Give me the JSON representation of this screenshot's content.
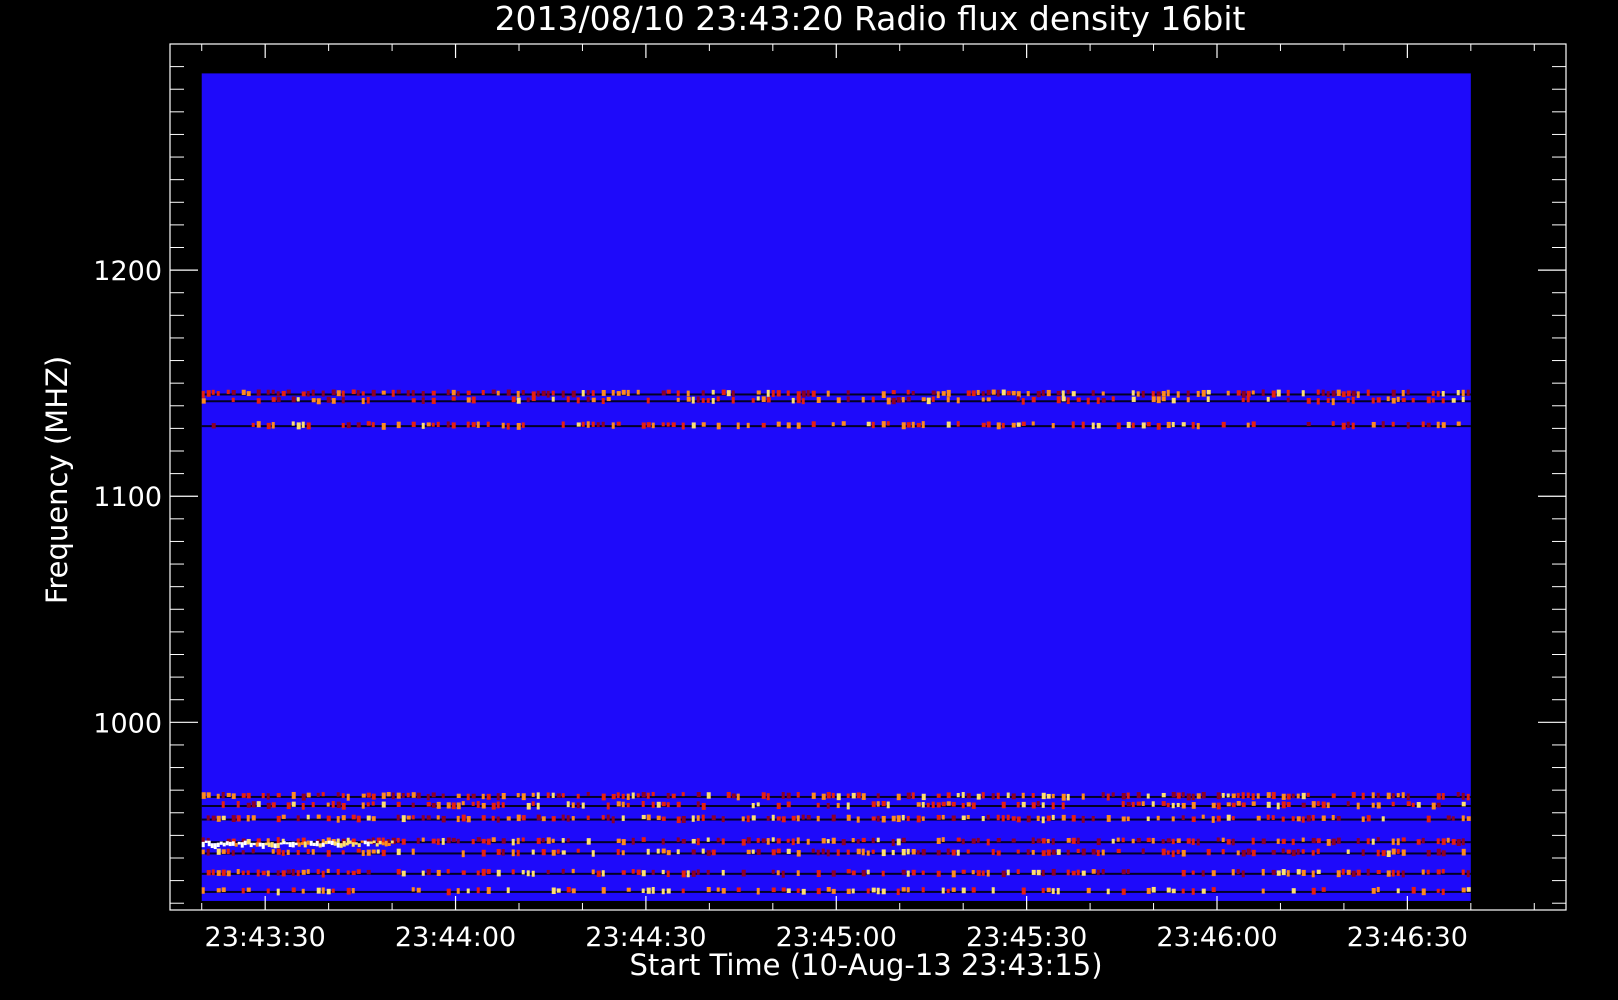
{
  "chart_data": {
    "type": "heatmap",
    "title": "2013/08/10 23:43:20 Radio flux density 16bit",
    "xlabel": "Start Time (10-Aug-13 23:43:15)",
    "ylabel": "Frequency (MHZ)",
    "x_start": "23:43:15",
    "xlim_seconds_after_start": [
      0,
      220
    ],
    "data_seconds_after_start": [
      5,
      205
    ],
    "ylim": [
      917,
      1300
    ],
    "data_freq_range": [
      921,
      1287
    ],
    "x_tick_labels": [
      "23:43:30",
      "23:44:00",
      "23:44:30",
      "23:45:00",
      "23:45:30",
      "23:46:00",
      "23:46:30"
    ],
    "x_tick_seconds": [
      15,
      45,
      75,
      105,
      135,
      165,
      195
    ],
    "y_tick_labels": [
      "1000",
      "1100",
      "1200"
    ],
    "y_tick_values": [
      1000,
      1100,
      1200
    ],
    "background_color": "#1e0afa",
    "intensity_colors": [
      "#1e0afa",
      "#000000",
      "#8c0028",
      "#e62010",
      "#ff8a1e",
      "#ffe070",
      "#ffffff"
    ],
    "emission_bands": [
      {
        "freq_mhz": 1145,
        "intensity": 0.8
      },
      {
        "freq_mhz": 1142,
        "intensity": 0.6
      },
      {
        "freq_mhz": 1131,
        "intensity": 0.6
      },
      {
        "freq_mhz": 967,
        "intensity": 0.8
      },
      {
        "freq_mhz": 963,
        "intensity": 0.6
      },
      {
        "freq_mhz": 957,
        "intensity": 0.7
      },
      {
        "freq_mhz": 947,
        "intensity": 0.8
      },
      {
        "freq_mhz": 942,
        "intensity": 0.7
      },
      {
        "freq_mhz": 933,
        "intensity": 0.7
      },
      {
        "freq_mhz": 925,
        "intensity": 0.4
      }
    ],
    "bright_burst": {
      "freq_mhz": 946,
      "seconds_after_start": [
        5,
        35
      ],
      "intensity": 1.0
    }
  }
}
